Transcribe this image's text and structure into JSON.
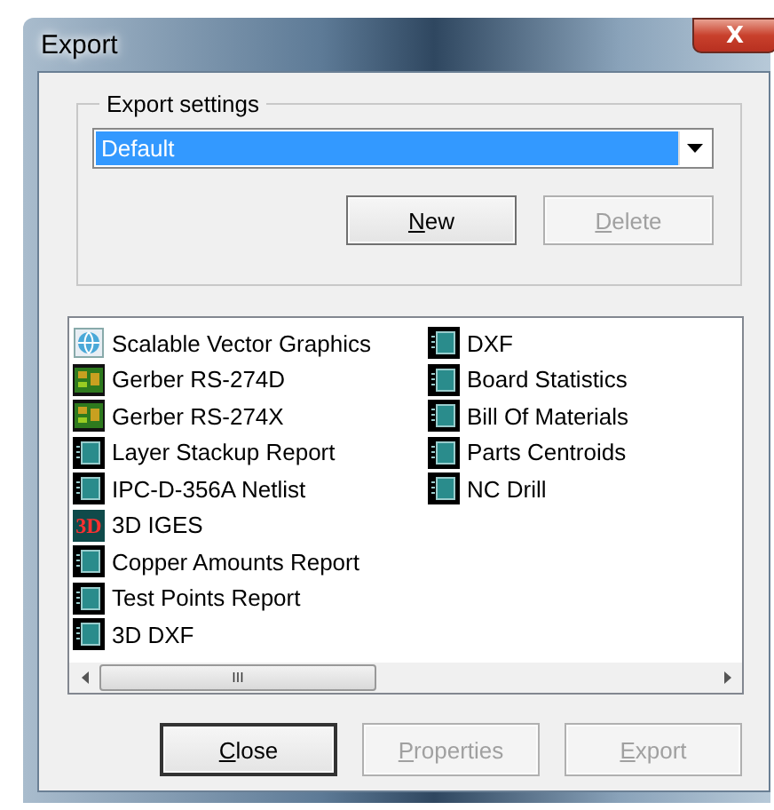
{
  "window": {
    "title": "Export",
    "close_glyph": "X"
  },
  "export_settings": {
    "label": "Export settings",
    "dropdown": {
      "value": "Default",
      "selected": true
    },
    "buttons": [
      {
        "label": "New",
        "disabled": false
      },
      {
        "label": "Delete",
        "disabled": true
      }
    ]
  },
  "formats": {
    "columns": [
      [
        {
          "label": "Scalable Vector Graphics",
          "kind": "web"
        },
        {
          "label": "Gerber RS-274D",
          "kind": "board"
        },
        {
          "label": "Gerber RS-274X",
          "kind": "board"
        },
        {
          "label": "Layer Stackup Report",
          "kind": "report"
        },
        {
          "label": "IPC-D-356A Netlist",
          "kind": "report"
        },
        {
          "label": "3D IGES",
          "kind": "model3d",
          "glyph": "3D"
        },
        {
          "label": "Copper Amounts Report",
          "kind": "report"
        },
        {
          "label": "Test Points Report",
          "kind": "report"
        },
        {
          "label": "3D DXF",
          "kind": "report"
        }
      ],
      [
        {
          "label": "DXF",
          "kind": "report"
        },
        {
          "label": "Board Statistics",
          "kind": "report"
        },
        {
          "label": "Bill Of Materials",
          "kind": "report"
        },
        {
          "label": "Parts Centroids",
          "kind": "report"
        },
        {
          "label": "NC Drill",
          "kind": "report"
        }
      ]
    ],
    "scrollbar_glyph": "III"
  },
  "buttons": [
    {
      "label": "Close",
      "disabled": false,
      "focused": true
    },
    {
      "label": "Properties",
      "disabled": true,
      "focused": false
    },
    {
      "label": "Export",
      "disabled": true,
      "focused": false
    }
  ]
}
